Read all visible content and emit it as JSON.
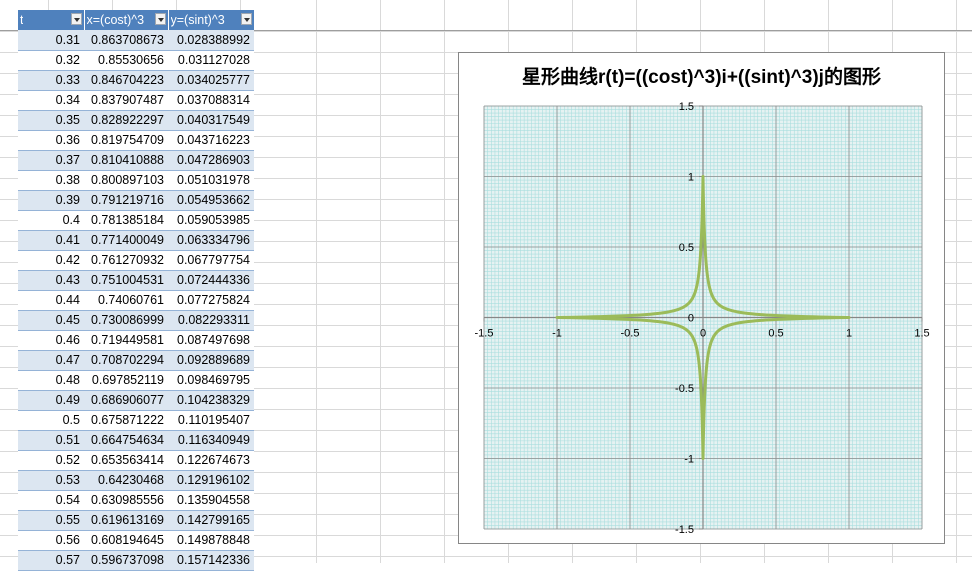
{
  "table": {
    "headers": [
      "t",
      "x=(cost)^3",
      "y=(sint)^3"
    ],
    "rows": [
      [
        "0.31",
        "0.863708673",
        "0.028388992"
      ],
      [
        "0.32",
        "0.85530656",
        "0.031127028"
      ],
      [
        "0.33",
        "0.846704223",
        "0.034025777"
      ],
      [
        "0.34",
        "0.837907487",
        "0.037088314"
      ],
      [
        "0.35",
        "0.828922297",
        "0.040317549"
      ],
      [
        "0.36",
        "0.819754709",
        "0.043716223"
      ],
      [
        "0.37",
        "0.810410888",
        "0.047286903"
      ],
      [
        "0.38",
        "0.800897103",
        "0.051031978"
      ],
      [
        "0.39",
        "0.791219716",
        "0.054953662"
      ],
      [
        "0.4",
        "0.781385184",
        "0.059053985"
      ],
      [
        "0.41",
        "0.771400049",
        "0.063334796"
      ],
      [
        "0.42",
        "0.761270932",
        "0.067797754"
      ],
      [
        "0.43",
        "0.751004531",
        "0.072444336"
      ],
      [
        "0.44",
        "0.74060761",
        "0.077275824"
      ],
      [
        "0.45",
        "0.730086999",
        "0.082293311"
      ],
      [
        "0.46",
        "0.719449581",
        "0.087497698"
      ],
      [
        "0.47",
        "0.708702294",
        "0.092889689"
      ],
      [
        "0.48",
        "0.697852119",
        "0.098469795"
      ],
      [
        "0.49",
        "0.686906077",
        "0.104238329"
      ],
      [
        "0.5",
        "0.675871222",
        "0.110195407"
      ],
      [
        "0.51",
        "0.664754634",
        "0.116340949"
      ],
      [
        "0.52",
        "0.653563414",
        "0.122674673"
      ],
      [
        "0.53",
        "0.64230468",
        "0.129196102"
      ],
      [
        "0.54",
        "0.630985556",
        "0.135904558"
      ],
      [
        "0.55",
        "0.619613169",
        "0.142799165"
      ],
      [
        "0.56",
        "0.608194645",
        "0.149878848"
      ],
      [
        "0.57",
        "0.596737098",
        "0.157142336"
      ]
    ]
  },
  "chart_data": {
    "type": "scatter",
    "title": "星形曲线r(t)=((cost)^3)i+((sint)^3)j的图形",
    "xlabel": "",
    "ylabel": "",
    "xlim": [
      -1.5,
      1.5
    ],
    "ylim": [
      -1.5,
      1.5
    ],
    "x_ticks": [
      -1.5,
      -1,
      -0.5,
      0,
      0.5,
      1,
      1.5
    ],
    "y_ticks": [
      -1.5,
      -1,
      -0.5,
      0,
      0.5,
      1,
      1.5
    ],
    "x_tick_labels": [
      "-1.5",
      "-1",
      "-0.5",
      "0",
      "0.5",
      "1",
      "1.5"
    ],
    "y_tick_labels": [
      "-1.5",
      "-1",
      "-0.5",
      "0",
      "0.5",
      "1",
      "1.5"
    ],
    "grid": true,
    "minor_grid": true,
    "curve": "astroid: x=(cos t)^3, y=(sin t)^3, t from 0 to 2π",
    "series": [
      {
        "x": [
          1,
          0.9952,
          0.9812,
          0.9585,
          0.9282,
          0.8912,
          0.8491,
          0.8031,
          0.7546,
          0.7049,
          0.655,
          0.6061,
          0.5587,
          0.5136,
          0.4711,
          0.4315,
          0.3949,
          0.3612,
          0.3305,
          0.3025,
          0.2771,
          0.254,
          0.2331,
          0.2141,
          0.1969,
          0.1812,
          0.167,
          0.154,
          0.1421,
          0.1312,
          0.1212,
          0.112,
          0.1035,
          0.0956,
          0.0883,
          0.0815,
          0.0751,
          0.0692,
          0.0636,
          0.0584,
          0.0535,
          0.0489,
          0.0446,
          0.0405,
          0.0366,
          0.033,
          0.0296,
          0.0264,
          0.0234,
          0.0206,
          0.018,
          0.0156,
          0.0134,
          0.0113,
          0.0095,
          0.0078,
          0.0062,
          0.0049,
          0.0037,
          0.0027,
          0.0018,
          0.0011,
          0.0006,
          0.0002,
          3e-05,
          0
        ],
        "y": [
          0,
          3e-05,
          0.0002,
          0.0006,
          0.0011,
          0.0018,
          0.0027,
          0.0037,
          0.0049,
          0.0062,
          0.0078,
          0.0095,
          0.0113,
          0.0134,
          0.0156,
          0.018,
          0.0206,
          0.0234,
          0.0264,
          0.0296,
          0.033,
          0.0366,
          0.0405,
          0.0446,
          0.0489,
          0.0535,
          0.0584,
          0.0636,
          0.0692,
          0.0751,
          0.0815,
          0.0883,
          0.0956,
          0.1035,
          0.112,
          0.1212,
          0.1312,
          0.1421,
          0.154,
          0.167,
          0.1812,
          0.1969,
          0.2141,
          0.2331,
          0.254,
          0.2771,
          0.3025,
          0.3305,
          0.3612,
          0.3949,
          0.4315,
          0.4711,
          0.5136,
          0.5587,
          0.6061,
          0.655,
          0.7049,
          0.7546,
          0.8031,
          0.8491,
          0.8912,
          0.9282,
          0.9585,
          0.9812,
          0.9952,
          1
        ],
        "symmetry": "quadrant-I points; curve mirrored into all four quadrants",
        "color": "#9bbb59"
      }
    ],
    "colors": {
      "plot_bg": "#e6f2f2",
      "minor_grid": "#a9dede",
      "major_grid": "#8c8c8c",
      "axis": "#868686"
    }
  }
}
